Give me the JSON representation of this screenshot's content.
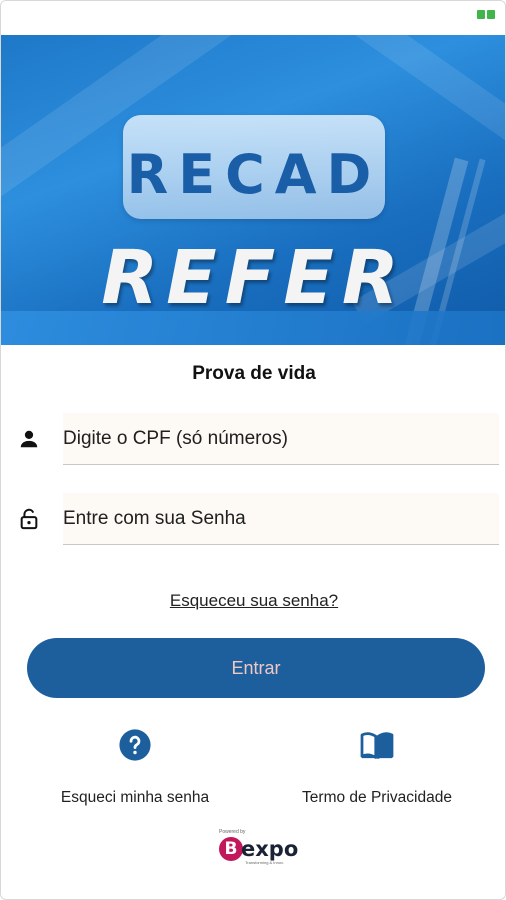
{
  "banner": {
    "line1": "RECAD",
    "line2": "REFER"
  },
  "page": {
    "title": "Prova de vida"
  },
  "form": {
    "cpf_placeholder": "Digite o CPF (só números)",
    "senha_placeholder": "Entre com sua Senha",
    "forgot_link": "Esqueceu sua senha?",
    "submit_label": "Entrar"
  },
  "actions": {
    "forgot_label": "Esqueci minha senha",
    "privacy_label": "Termo de Privacidade"
  },
  "footer": {
    "powered_by": "Powered by",
    "logo_letter": "B",
    "logo_word": "expo",
    "logo_tagline": "Transforming & Innov."
  },
  "colors": {
    "primary": "#1d5f9d",
    "button_text": "#f1c7c2",
    "banner_blue": "#2d8fde",
    "battery_green": "#3fb54a"
  },
  "icons": [
    "battery-icon",
    "user-icon",
    "lock-icon",
    "help-icon",
    "book-icon"
  ]
}
